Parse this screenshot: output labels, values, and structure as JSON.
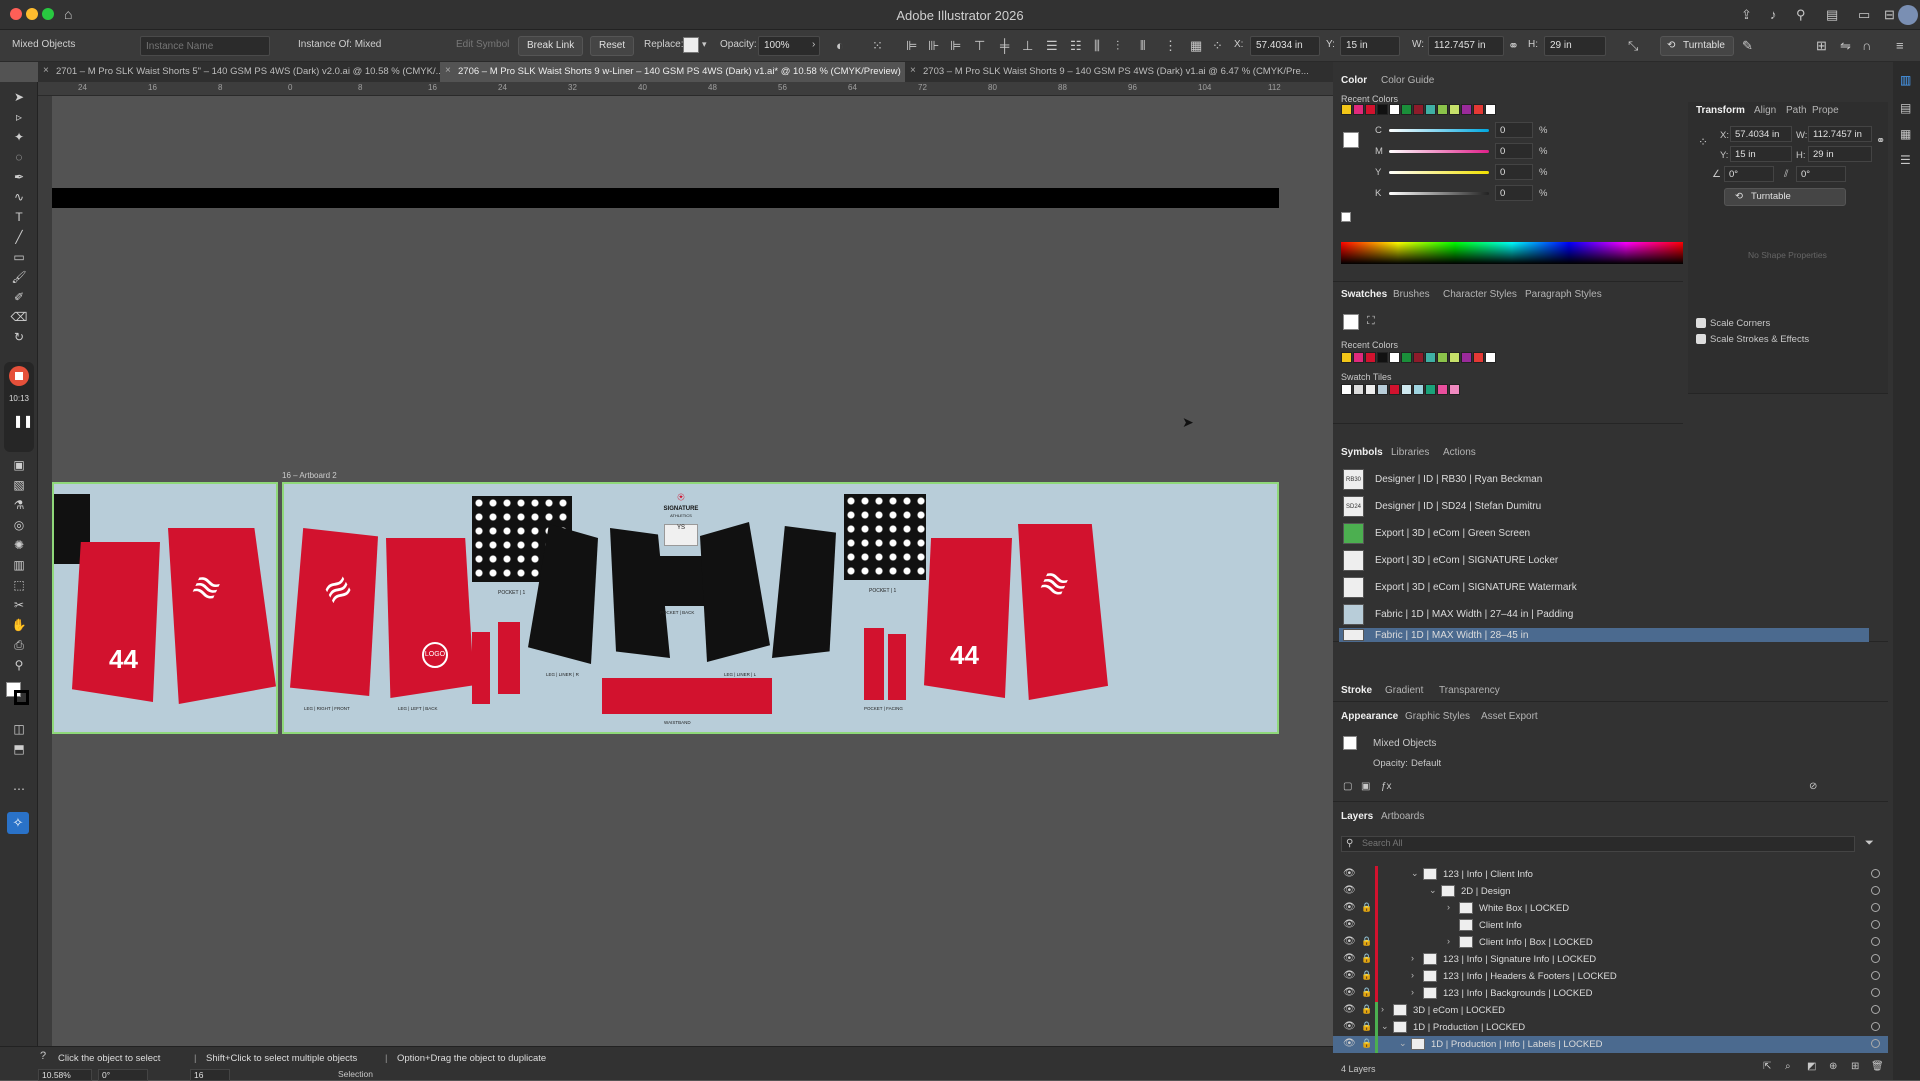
{
  "app": {
    "title": "Adobe Illustrator 2026"
  },
  "colors": {
    "accent": "#d2122e",
    "panel": "#323232",
    "canvas": "#535353",
    "artboard": "#b8cdd9",
    "selection": "#4b6a8f"
  },
  "control_bar": {
    "selection_label": "Mixed Objects",
    "instance_name_placeholder": "Instance Name",
    "instance_of": "Instance Of: Mixed",
    "edit_symbol": "Edit Symbol",
    "break_link": "Break Link",
    "reset": "Reset",
    "replace_label": "Replace:",
    "opacity_label": "Opacity:",
    "opacity_value": "100%",
    "x_label": "X:",
    "x_value": "57.4034 in",
    "y_label": "Y:",
    "y_value": "15 in",
    "w_label": "W:",
    "w_value": "112.7457 in",
    "h_label": "H:",
    "h_value": "29 in",
    "turntable": "Turntable"
  },
  "doc_tabs": [
    {
      "label": "2701 – M Pro SLK Waist Shorts 5\" – 140 GSM PS 4WS (Dark) v2.0.ai @ 10.58 % (CMYK/...",
      "active": false
    },
    {
      "label": "2706 – M Pro SLK Waist Shorts 9 w-Liner – 140 GSM PS 4WS (Dark) v1.ai* @ 10.58 % (CMYK/Preview)",
      "active": true
    },
    {
      "label": "2703 – M Pro SLK Waist Shorts 9 – 140 GSM PS 4WS (Dark) v1.ai @ 6.47 % (CMYK/Pre...",
      "active": false
    }
  ],
  "ruler_marks": [
    "24",
    "16",
    "8",
    "0",
    "8",
    "16",
    "24",
    "32",
    "40",
    "48",
    "56",
    "64",
    "72",
    "80",
    "88",
    "96",
    "104",
    "112"
  ],
  "recording": {
    "time": "10:13"
  },
  "artboard": {
    "label": "16 – Artboard 2",
    "brand_name": "SIGNATURE",
    "brand_sub": "ATHLETICS",
    "ys": "YS",
    "logo": "LOGO",
    "number": "44",
    "waistband_label": "WAISTBAND",
    "part_labels": [
      "POCKET | 1",
      "POCKET | BACK",
      "POCKET | 1",
      "LEG | LEFT | BACK",
      "LEG | RIGHT | FRONT",
      "LEG | LINER | R",
      "LEG | LINER | L",
      "POCKET | FACING"
    ]
  },
  "status": {
    "hint_a": "Click the object to select",
    "hint_b": "Shift+Click to select multiple objects",
    "hint_c": "Option+Drag the object to duplicate",
    "zoom": "10.58%",
    "rotate": "0°",
    "artboard_no": "16",
    "tool": "Selection"
  },
  "color_panel": {
    "tabs": [
      "Color",
      "Color Guide"
    ],
    "recent_label": "Recent Colors",
    "channels": [
      {
        "name": "C",
        "value": "0",
        "color": "#00a8e0"
      },
      {
        "name": "M",
        "value": "0",
        "color": "#e0208a"
      },
      {
        "name": "Y",
        "value": "0",
        "color": "#f0e000"
      },
      {
        "name": "K",
        "value": "0",
        "color": "#888888"
      }
    ],
    "pct": "%",
    "recent_swatches": [
      "#f2c618",
      "#e02a7c",
      "#d2122e",
      "#111111",
      "#ffffff",
      "#1a8f3a",
      "#8e1b2a",
      "#3fb0a5",
      "#8bc34a",
      "#c6e06a",
      "#9a2a9a",
      "#e53935",
      "#ffffff"
    ]
  },
  "swatches_panel": {
    "tabs": [
      "Swatches",
      "Brushes",
      "Character Styles",
      "Paragraph Styles"
    ],
    "recent_label": "Recent Colors",
    "tiles_label": "Swatch Tiles"
  },
  "transform_panel": {
    "tabs": [
      "Transform",
      "Align",
      "Path",
      "Prope"
    ],
    "x_label": "X:",
    "x_value": "57.4034 in",
    "w_label": "W:",
    "w_value": "112.7457 in",
    "y_label": "Y:",
    "y_value": "15 in",
    "h_label": "H:",
    "h_value": "29 in",
    "angle_value": "0°",
    "shear_value": "0°",
    "turntable": "Turntable",
    "no_shape": "No Shape Properties",
    "scale_corners": "Scale Corners",
    "scale_strokes": "Scale Strokes & Effects"
  },
  "symbols_panel": {
    "tabs": [
      "Symbols",
      "Libraries",
      "Actions"
    ],
    "items": [
      {
        "label": "Designer | ID | RB30 | Ryan Beckman",
        "thumb": "RB30",
        "color": "#e8e8e8"
      },
      {
        "label": "Designer | ID | SD24 | Stefan Dumitru",
        "thumb": "SD24",
        "color": "#e8e8e8"
      },
      {
        "label": "Export | 3D | eCom | Green Screen",
        "thumb": "",
        "color": "#4caf50"
      },
      {
        "label": "Export | 3D | eCom | SIGNATURE Locker",
        "thumb": "",
        "color": "#f4f4f4"
      },
      {
        "label": "Export | 3D | eCom | SIGNATURE Watermark",
        "thumb": "",
        "color": "#f4f4f4"
      },
      {
        "label": "Fabric | 1D | MAX Width | 27–44 in | Padding",
        "thumb": "",
        "color": "#b8cdd9"
      },
      {
        "label": "Fabric | 1D | MAX Width | 28–45 in",
        "thumb": "",
        "color": "#f4f4f4"
      }
    ]
  },
  "stroke_panel": {
    "tabs": [
      "Stroke",
      "Gradient",
      "Transparency"
    ]
  },
  "appearance_panel": {
    "tabs": [
      "Appearance",
      "Graphic Styles",
      "Asset Export"
    ],
    "object": "Mixed Objects",
    "opacity": "Opacity:",
    "opacity_value": "Default"
  },
  "layers_panel": {
    "tabs": [
      "Layers",
      "Artboards"
    ],
    "search_placeholder": "Search All",
    "footer": "4 Layers",
    "rows": [
      {
        "name": "123 | Info | Client Info",
        "indent": 2,
        "locked": false,
        "caret": "v"
      },
      {
        "name": "2D | Design",
        "indent": 3,
        "locked": false,
        "caret": "v"
      },
      {
        "name": "White Box | LOCKED",
        "indent": 4,
        "locked": true,
        "caret": ">"
      },
      {
        "name": "Client Info",
        "indent": 4,
        "locked": false,
        "caret": ""
      },
      {
        "name": "Client Info | Box | LOCKED",
        "indent": 4,
        "locked": true,
        "caret": ">"
      },
      {
        "name": "123 | Info | Signature Info | LOCKED",
        "indent": 2,
        "locked": true,
        "caret": ">"
      },
      {
        "name": "123 | Info | Headers & Footers | LOCKED",
        "indent": 2,
        "locked": true,
        "caret": ">"
      },
      {
        "name": "123 | Info | Backgrounds | LOCKED",
        "indent": 2,
        "locked": true,
        "caret": ">"
      },
      {
        "name": "3D | eCom | LOCKED",
        "indent": 0,
        "locked": true,
        "caret": ">"
      },
      {
        "name": "1D | Production | LOCKED",
        "indent": 0,
        "locked": true,
        "caret": "v"
      },
      {
        "name": "1D | Production | Info | Labels | LOCKED",
        "indent": 1,
        "locked": true,
        "caret": "v"
      }
    ]
  }
}
